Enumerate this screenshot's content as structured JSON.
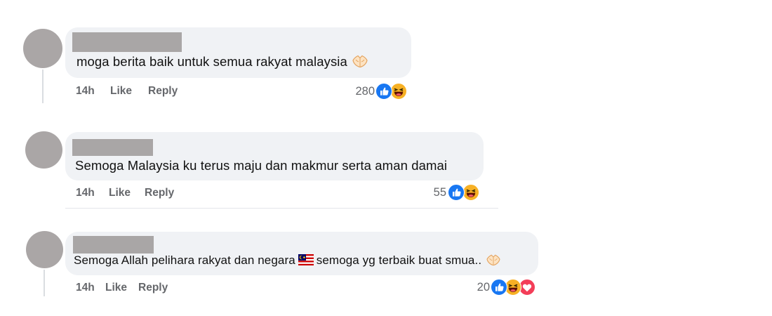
{
  "comments": [
    {
      "text": "moga berita baik untuk semua rakyat malaysia",
      "time": "14h",
      "like_label": "Like",
      "reply_label": "Reply",
      "reaction_count": "280",
      "reactions": [
        "like-icon",
        "haha-icon"
      ]
    },
    {
      "text": "Semoga Malaysia ku terus maju dan makmur serta aman damai",
      "time": "14h",
      "like_label": "Like",
      "reply_label": "Reply",
      "reaction_count": "55",
      "reactions": [
        "like-icon",
        "haha-icon"
      ]
    },
    {
      "text_part1": "Semoga Allah pelihara rakyat dan negara",
      "text_part2": "semoga yg terbaik buat smua..",
      "time": "14h",
      "like_label": "Like",
      "reply_label": "Reply",
      "reaction_count": "20",
      "reactions": [
        "like-icon",
        "haha-icon",
        "love-icon"
      ]
    }
  ],
  "colors": {
    "bubble": "#f0f2f5",
    "meta_text": "#65676b",
    "like_blue": "#1877f2",
    "love_red": "#f33e58",
    "haha_yellow": "#f7b125",
    "redaction": "#a9a6a6"
  }
}
